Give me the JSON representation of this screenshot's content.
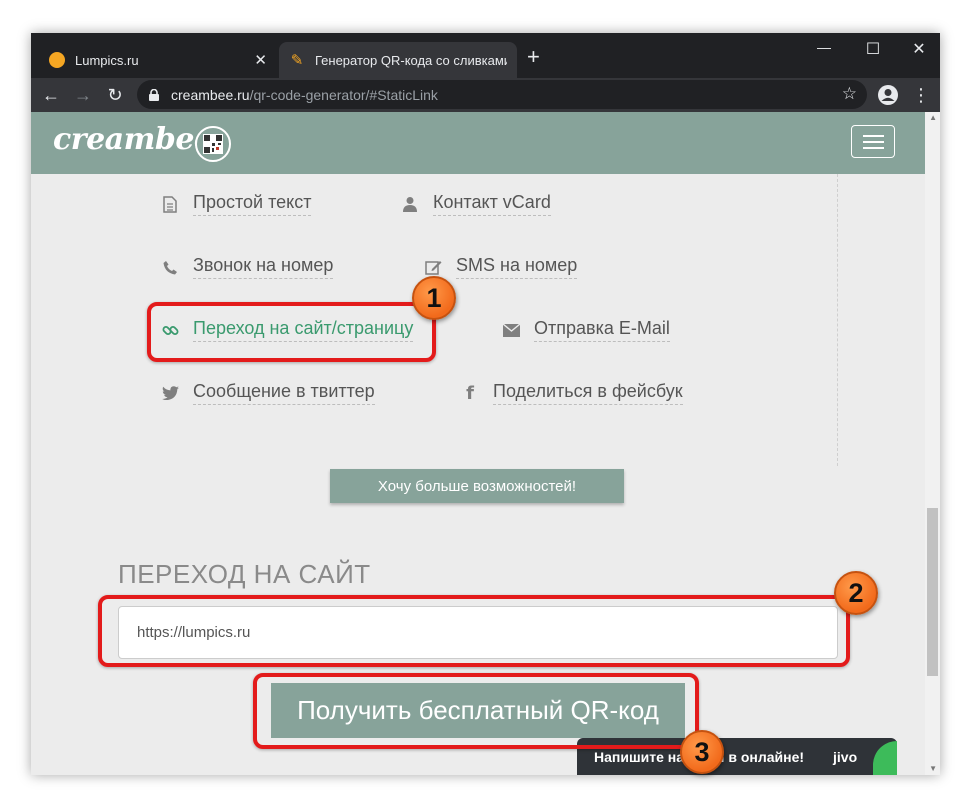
{
  "browser": {
    "tabs": [
      {
        "title": "Lumpics.ru",
        "favicon_color": "#f5a623",
        "active": false
      },
      {
        "title": "Генератор QR-кода со сливками",
        "favicon_color": "#f5a623",
        "active": true
      }
    ],
    "new_tab_label": "+",
    "address": {
      "host": "creambee.ru",
      "path": "/qr-code-generator/#StaticLink"
    },
    "window_controls": {
      "minimize": "—",
      "maximize": "☐",
      "close": "✕"
    }
  },
  "site": {
    "logo_text": "creambee",
    "header_color": "#87a39a",
    "accent_color": "#3a9a6e"
  },
  "options": [
    {
      "label": "Простой текст",
      "icon": "document-icon",
      "selected": false
    },
    {
      "label": "Контакт vCard",
      "icon": "user-icon",
      "selected": false
    },
    {
      "label": "Звонок на номер",
      "icon": "phone-icon",
      "selected": false
    },
    {
      "label": "SMS на номер",
      "icon": "edit-icon",
      "selected": false
    },
    {
      "label": "Переход на сайт/страницу",
      "icon": "link-icon",
      "selected": true
    },
    {
      "label": "Отправка E-Mail",
      "icon": "envelope-icon",
      "selected": false
    },
    {
      "label": "Сообщение в твиттер",
      "icon": "twitter-icon",
      "selected": false
    },
    {
      "label": "Поделиться в фейсбук",
      "icon": "facebook-icon",
      "selected": false
    }
  ],
  "more_button_label": "Хочу больше возможностей!",
  "section_title": "ПЕРЕХОД НА САЙТ",
  "url_input": {
    "value": "https://lumpics.ru",
    "placeholder": ""
  },
  "get_qr_button_label": "Получить бесплатный QR-код",
  "chat_widget": {
    "message": "Напишите нам, мы в онлайне!",
    "brand": "jivo"
  },
  "annotations": {
    "badge_1": "1",
    "badge_2": "2",
    "badge_3": "3",
    "highlight_color": "#e31b1b",
    "badge_color": "#f26a1b"
  }
}
